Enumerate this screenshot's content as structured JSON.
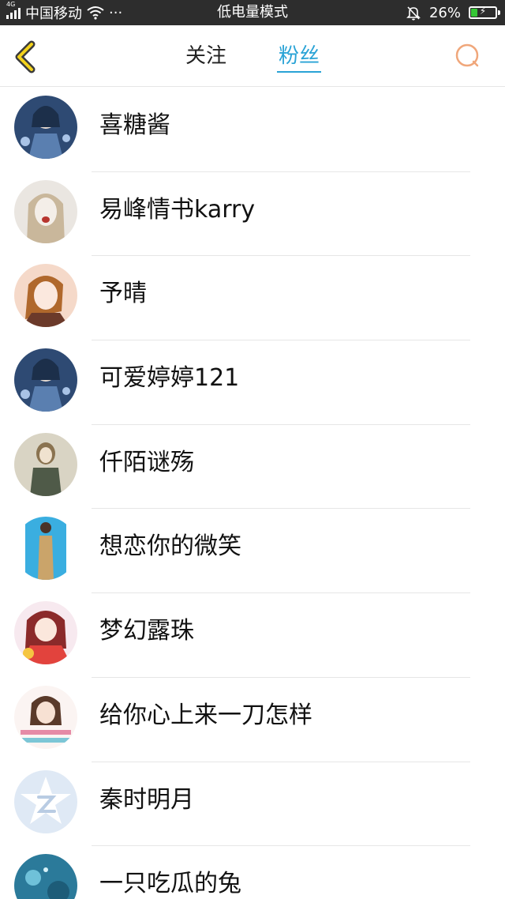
{
  "status_bar": {
    "network": "4G",
    "carrier": "中国移动",
    "more": "···",
    "mode": "低电量模式",
    "battery_percent": "26%",
    "battery_level": 0.26
  },
  "nav": {
    "back_icon": "chevron-left-icon",
    "tabs": [
      {
        "label": "关注",
        "active": false
      },
      {
        "label": "粉丝",
        "active": true
      }
    ],
    "search_icon": "search-icon",
    "accent_color": "#2aa3d6"
  },
  "fans": [
    {
      "name": "喜糖酱"
    },
    {
      "name": "易峰情书karry"
    },
    {
      "name": "予晴"
    },
    {
      "name": "可爱婷婷121"
    },
    {
      "name": "仟陌谜殇"
    },
    {
      "name": "想恋你的微笑"
    },
    {
      "name": "梦幻露珠"
    },
    {
      "name": "给你心上来一刀怎样"
    },
    {
      "name": "秦时明月"
    },
    {
      "name": "一只吃瓜的兔"
    }
  ]
}
